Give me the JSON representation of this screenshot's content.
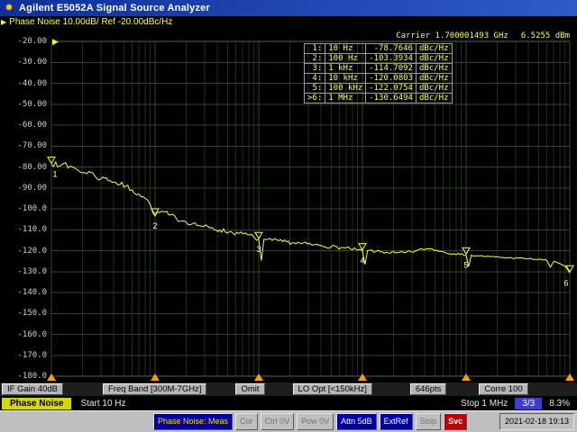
{
  "title_bar": {
    "title": "Agilent E5052A Signal Source Analyzer"
  },
  "trace_info": {
    "label": "Phase Noise 10.00dB/ Ref -20.00dBc/Hz"
  },
  "carrier": {
    "text": "Carrier 1.700001493 GHz",
    "power": "6.5255 dBm"
  },
  "marker_table": {
    "rows": [
      {
        "num": "1:",
        "freq": "10 Hz",
        "value": "-78.7646",
        "unit": "dBc/Hz"
      },
      {
        "num": "2:",
        "freq": "100 Hz",
        "value": "-103.3934",
        "unit": "dBc/Hz"
      },
      {
        "num": "3:",
        "freq": "1 kHz",
        "value": "-114.7092",
        "unit": "dBc/Hz"
      },
      {
        "num": "4:",
        "freq": "10 kHz",
        "value": "-120.0803",
        "unit": "dBc/Hz"
      },
      {
        "num": "5:",
        "freq": "100 kHz",
        "value": "-122.0754",
        "unit": "dBc/Hz"
      },
      {
        "num": ">6:",
        "freq": "1 MHz",
        "value": "-130.6494",
        "unit": "dBc/Hz"
      }
    ]
  },
  "chart_data": {
    "type": "line",
    "title": "Phase Noise 10.00dB/ Ref -20.00dBc/Hz",
    "x_scale": "log",
    "x_range_hz": [
      10,
      1000000
    ],
    "ylim": [
      -180,
      -20
    ],
    "y_step_db": 10,
    "y_axis_ticks": [
      "-20.00",
      "-30.00",
      "-40.00",
      "-50.00",
      "-60.00",
      "-70.00",
      "-80.00",
      "-90.00",
      "-100.0",
      "-110.0",
      "-120.0",
      "-130.0",
      "-140.0",
      "-150.0",
      "-160.0",
      "-170.0",
      "-180.0"
    ],
    "x_marker_ticks_hz": [
      10,
      100,
      1000,
      10000,
      100000,
      1000000
    ],
    "trace_color": "#ffff33",
    "grid_major_color": "#2c472c",
    "grid_minor_color": "#1c2f1c",
    "marker_tick_color": "#ff9c00",
    "points": [
      [
        10,
        -78.8
      ],
      [
        11,
        -77.6
      ],
      [
        12,
        -79.6
      ],
      [
        13,
        -78.4
      ],
      [
        14.5,
        -80.5
      ],
      [
        16,
        -80.0
      ],
      [
        18,
        -81.5
      ],
      [
        20,
        -82.8
      ],
      [
        23,
        -82.2
      ],
      [
        26,
        -84.0
      ],
      [
        30,
        -85.8
      ],
      [
        34,
        -85.2
      ],
      [
        40,
        -87.2
      ],
      [
        46,
        -88.4
      ],
      [
        52,
        -89.2
      ],
      [
        60,
        -91.0
      ],
      [
        70,
        -93.0
      ],
      [
        80,
        -95.0
      ],
      [
        90,
        -98.0
      ],
      [
        100,
        -103.39
      ],
      [
        115,
        -101.2
      ],
      [
        135,
        -102.8
      ],
      [
        160,
        -104.5
      ],
      [
        190,
        -105.8
      ],
      [
        230,
        -107.0
      ],
      [
        280,
        -108.2
      ],
      [
        340,
        -109.2
      ],
      [
        420,
        -110.2
      ],
      [
        520,
        -111.0
      ],
      [
        640,
        -111.8
      ],
      [
        780,
        -112.4
      ],
      [
        900,
        -113.6
      ],
      [
        1000,
        -114.71
      ],
      [
        1060,
        -124.8
      ],
      [
        1120,
        -114.6
      ],
      [
        1350,
        -115.1
      ],
      [
        1700,
        -115.7
      ],
      [
        2100,
        -116.2
      ],
      [
        2600,
        -116.6
      ],
      [
        3200,
        -117.1
      ],
      [
        4000,
        -117.6
      ],
      [
        5000,
        -118.1
      ],
      [
        6200,
        -118.6
      ],
      [
        7600,
        -119.1
      ],
      [
        8800,
        -119.6
      ],
      [
        10000,
        -120.08
      ],
      [
        10600,
        -126.6
      ],
      [
        11200,
        -119.9
      ],
      [
        13500,
        -120.4
      ],
      [
        17000,
        -120.8
      ],
      [
        21000,
        -121.1
      ],
      [
        26000,
        -120.9
      ],
      [
        32000,
        -120.3
      ],
      [
        38000,
        -119.3
      ],
      [
        45000,
        -119.0
      ],
      [
        52000,
        -119.8
      ],
      [
        62000,
        -120.7
      ],
      [
        76000,
        -121.4
      ],
      [
        88000,
        -121.8
      ],
      [
        100000,
        -122.08
      ],
      [
        106000,
        -127.6
      ],
      [
        112000,
        -122.2
      ],
      [
        135000,
        -122.5
      ],
      [
        170000,
        -122.9
      ],
      [
        210000,
        -123.2
      ],
      [
        260000,
        -123.4
      ],
      [
        320000,
        -123.6
      ],
      [
        400000,
        -123.9
      ],
      [
        500000,
        -124.2
      ],
      [
        600000,
        -124.7
      ],
      [
        650000,
        -127.9
      ],
      [
        700000,
        -125.1
      ],
      [
        800000,
        -126.1
      ],
      [
        900000,
        -127.4
      ],
      [
        950000,
        -128.8
      ],
      [
        1000000,
        -130.65
      ]
    ],
    "markers": [
      {
        "n": "1",
        "hz": 10,
        "db": -78.7646
      },
      {
        "n": "2",
        "hz": 100,
        "db": -103.3934
      },
      {
        "n": "3",
        "hz": 1000,
        "db": -114.7092
      },
      {
        "n": "4",
        "hz": 10000,
        "db": -120.0803
      },
      {
        "n": "5",
        "hz": 100000,
        "db": -122.0754
      },
      {
        "n": "6",
        "hz": 1000000,
        "db": -130.6494
      }
    ]
  },
  "status_row1": {
    "items": [
      "IF Gain 40dB",
      "Freq Band [300M-7GHz]",
      "Omit",
      "LO Opt [<150kHz]",
      "646pts",
      "Corre 100"
    ]
  },
  "status_row2": {
    "trace_tab": "Phase Noise",
    "start": "Start 10 Hz",
    "stop": "Stop 1 MHz",
    "page": "3/3",
    "percent": "8.3%"
  },
  "taskbar": {
    "items": [
      {
        "label": "Phase Noise: Meas",
        "style": "active"
      },
      {
        "label": "Cor",
        "style": "dim"
      },
      {
        "label": "Ctrl 0V",
        "style": "dim"
      },
      {
        "label": "Pow 0V",
        "style": "dim"
      },
      {
        "label": "Attn 5dB",
        "style": "blue"
      },
      {
        "label": "ExtRef",
        "style": "blue"
      },
      {
        "label": "Stop",
        "style": "dim"
      },
      {
        "label": "Svc",
        "style": "red"
      }
    ],
    "datetime": "2021-02-18 19:13"
  },
  "colors": {
    "titlebar": "#10309a",
    "trace": "#ffff33",
    "marker_text": "#ffffff",
    "trace_tab_bg": "#d6d600",
    "page_badge_bg": "#3c3cd8",
    "taskbar_active_bg": "#0000a8",
    "svc_bg": "#c00000"
  }
}
